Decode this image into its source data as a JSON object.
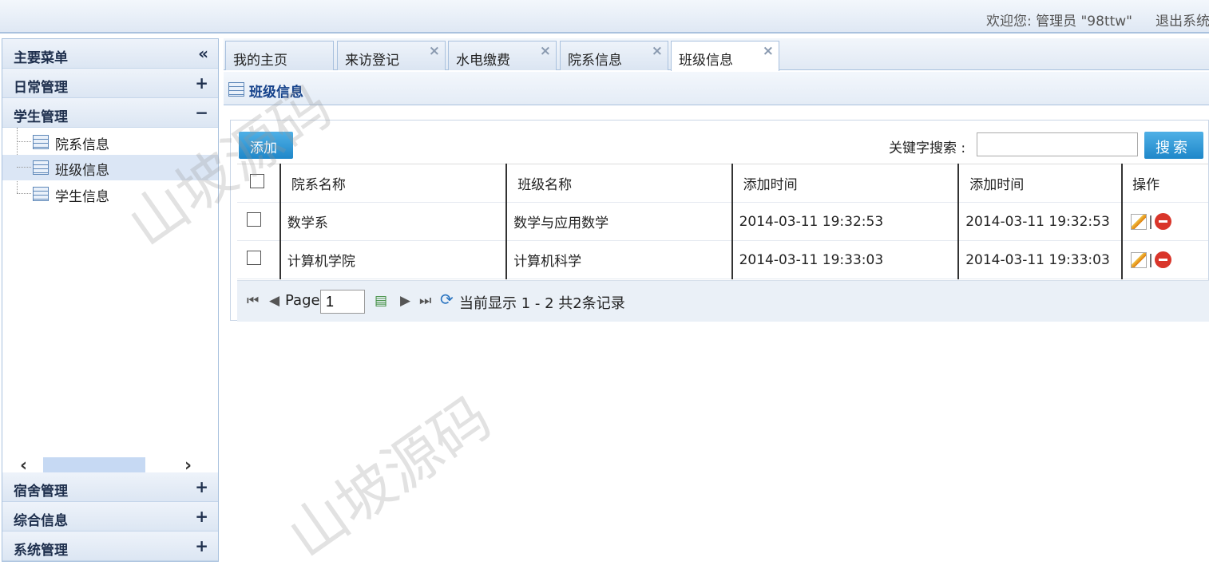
{
  "header": {
    "welcome": "欢迎您: 管理员 \"98ttw\"",
    "logout": "退出系统"
  },
  "sidebar": {
    "title": "主要菜单",
    "collapse_icon": "«",
    "panels": {
      "daily": {
        "label": "日常管理",
        "icon": "+"
      },
      "student": {
        "label": "学生管理",
        "icon": "−"
      },
      "dorm": {
        "label": "宿舍管理",
        "icon": "+"
      },
      "general": {
        "label": "综合信息",
        "icon": "+"
      },
      "system": {
        "label": "系统管理",
        "icon": "+"
      }
    },
    "tree": [
      {
        "label": "院系信息"
      },
      {
        "label": "班级信息"
      },
      {
        "label": "学生信息"
      }
    ],
    "scroll_left": "‹",
    "scroll_right": "›"
  },
  "tabs": [
    {
      "label": "我的主页"
    },
    {
      "label": "来访登记",
      "close": "×"
    },
    {
      "label": "水电缴费",
      "close": "×"
    },
    {
      "label": "院系信息",
      "close": "×"
    },
    {
      "label": "班级信息",
      "close": "×"
    }
  ],
  "content": {
    "title": "班级信息",
    "add_button": "添加",
    "search_label": "关键字搜索 :",
    "search_value": "",
    "search_button": "搜索"
  },
  "table": {
    "columns": [
      "院系名称",
      "班级名称",
      "添加时间",
      "添加时间",
      "操作"
    ],
    "rows": [
      {
        "dept": "数学系",
        "class": "数学与应用数学",
        "time1": "2014-03-11 19:32:53",
        "time2": "2014-03-11 19:32:53"
      },
      {
        "dept": "计算机学院",
        "class": "计算机科学",
        "time1": "2014-03-11 19:33:03",
        "time2": "2014-03-11 19:33:03"
      }
    ],
    "action_sep": "|"
  },
  "pager": {
    "first": "⏮",
    "prev": "◀",
    "page_label": "Page",
    "page_value": "1",
    "next": "▶",
    "last": "⏭",
    "refresh": "⟳",
    "status": "当前显示 1 - 2   共2条记录"
  },
  "watermark": "山坡源码"
}
